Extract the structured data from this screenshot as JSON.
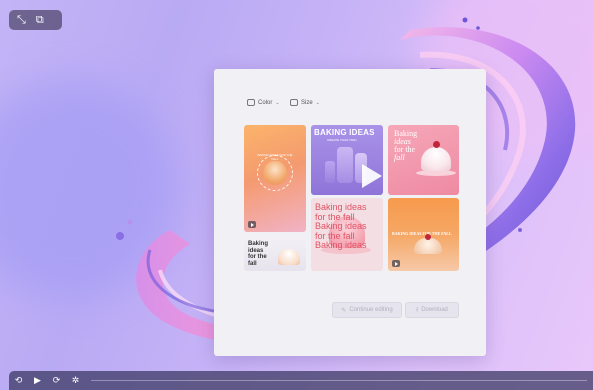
{
  "window": {
    "expand_icon": "expand-arrows-icon",
    "pip_icon": "picture-in-picture-icon"
  },
  "design_panel": {
    "toolbar": {
      "color_label": "Color",
      "size_label": "Size"
    },
    "cards": [
      {
        "name": "cupcake-post",
        "lettering": "BAKING IDEAS FOR THE FALL"
      },
      {
        "name": "baking-ideas-video",
        "title": "BAKING IDEAS",
        "subtitle": "CREATE YOUR OWN"
      },
      {
        "name": "cake-post",
        "title_lines": [
          "Baking",
          "ideas",
          "for the",
          "fall"
        ]
      },
      {
        "name": "cupcake-banner",
        "title_lines": [
          "Baking",
          "ideas",
          "for the",
          "fall"
        ]
      },
      {
        "name": "pink-cake-post",
        "title_lines": [
          "Baking ideas",
          "for the fall",
          "Baking ideas",
          "for the fall",
          "Baking ideas"
        ]
      },
      {
        "name": "orange-cake-video",
        "title": "BAKING IDEAS FOR THE FALL"
      }
    ],
    "actions": {
      "continue_label": "Continue editing",
      "download_label": "Download"
    }
  },
  "player": {
    "replay_back_label": "10",
    "play_icon": "play-icon",
    "forward_label": "10",
    "settings_icon": "loading-icon"
  }
}
